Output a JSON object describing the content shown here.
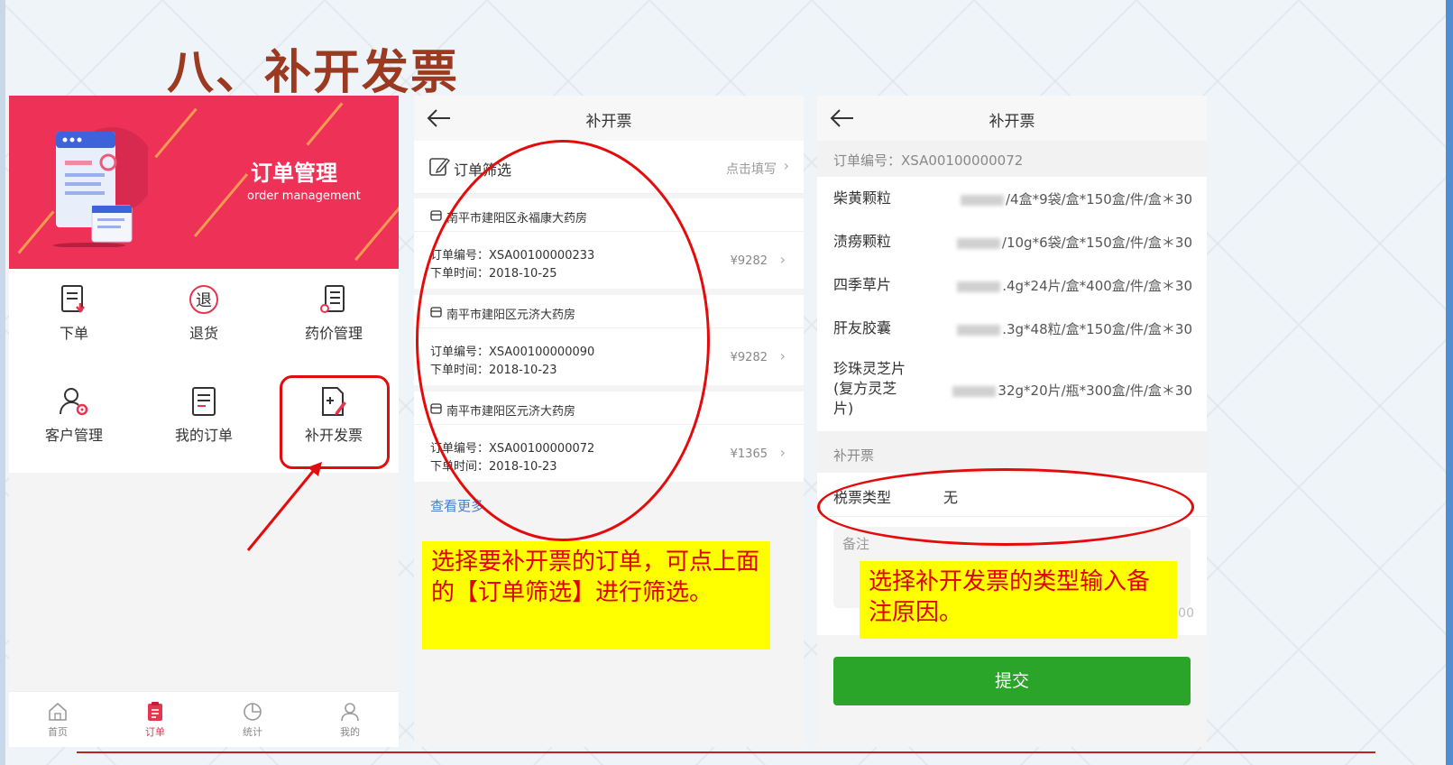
{
  "slide": {
    "title": "八、补开发票"
  },
  "menu_screen": {
    "banner_title": "订单管理",
    "banner_subtitle": "order management",
    "grid": [
      {
        "label": "下单",
        "icon": "order-form-icon"
      },
      {
        "label": "退货",
        "icon": "return-icon"
      },
      {
        "label": "药价管理",
        "icon": "price-list-icon"
      },
      {
        "label": "客户管理",
        "icon": "customer-gear-icon"
      },
      {
        "label": "我的订单",
        "icon": "my-orders-icon"
      },
      {
        "label": "补开发票",
        "icon": "invoice-edit-icon"
      }
    ],
    "tabs": [
      {
        "label": "首页",
        "icon": "home-icon"
      },
      {
        "label": "订单",
        "icon": "order-clipboard-icon"
      },
      {
        "label": "统计",
        "icon": "pie-chart-icon"
      },
      {
        "label": "我的",
        "icon": "user-icon"
      }
    ],
    "active_tab": "订单"
  },
  "order_list_screen": {
    "title": "补开票",
    "filter_label": "订单筛选",
    "filter_hint": "点击填写",
    "orders": [
      {
        "store": "南平市建阳区永福康大药房",
        "order_no": "订单编号：XSA00100000233",
        "date": "下单时间：2018-10-25",
        "amount": "¥9282"
      },
      {
        "store": "南平市建阳区元济大药房",
        "order_no": "订单编号：XSA00100000090",
        "date": "下单时间：2018-10-23",
        "amount": "¥9282"
      },
      {
        "store": "南平市建阳区元济大药房",
        "order_no": "订单编号：XSA00100000072",
        "date": "下单时间：2018-10-23",
        "amount": "¥1365"
      }
    ],
    "more_label": "查看更多",
    "note": "选择要补开票的订单，可点上面的【订单筛选】进行筛选。"
  },
  "invoice_screen": {
    "title": "补开票",
    "order_header": "订单编号：XSA00100000072",
    "products": [
      {
        "name": "柴黄颗粒",
        "spec": "/4盒*9袋/盒*150盒/件/盒＊30"
      },
      {
        "name": "渍痨颗粒",
        "spec": "/10g*6袋/盒*150盒/件/盒＊30"
      },
      {
        "name": "四季草片",
        "spec": ".4g*24片/盒*400盒/件/盒＊30"
      },
      {
        "name": "肝友胶囊",
        "spec": ".3g*48粒/盒*150盒/件/盒＊30"
      },
      {
        "name": "珍珠灵芝片(复方灵芝片)",
        "spec": "32g*20片/瓶*300盒/件/盒＊30"
      }
    ],
    "section_label": "补开票",
    "tax_label": "税票类型",
    "tax_value": "无",
    "remark_label": "备注",
    "remark_count_tail": "00",
    "note": "选择补开发票的类型输入备注原因。",
    "submit_label": "提交"
  },
  "colors": {
    "title": "#9b3a21",
    "banner": "#ee3157",
    "highlight": "#e30b0b",
    "submit": "#2aa52a",
    "note_bg": "#ffff00",
    "note_text": "#e00000"
  }
}
